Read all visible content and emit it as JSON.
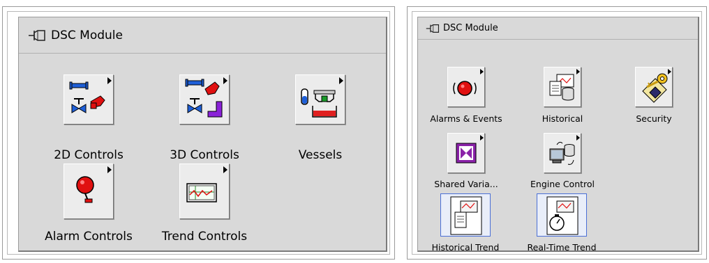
{
  "left_palette": {
    "title": "DSC Module",
    "items": [
      {
        "label": "2D Controls",
        "icon": "2d-controls-icon"
      },
      {
        "label": "3D Controls",
        "icon": "3d-controls-icon"
      },
      {
        "label": "Vessels",
        "icon": "vessels-icon"
      },
      {
        "label": "Alarm Controls",
        "icon": "alarm-controls-icon"
      },
      {
        "label": "Trend Controls",
        "icon": "trend-controls-icon"
      }
    ]
  },
  "right_palette": {
    "title": "DSC Module",
    "items": [
      {
        "label": "Alarms & Events",
        "icon": "alarms-events-icon"
      },
      {
        "label": "Historical",
        "icon": "historical-icon"
      },
      {
        "label": "Security",
        "icon": "security-icon"
      },
      {
        "label": "Shared Varia...",
        "icon": "shared-variable-icon"
      },
      {
        "label": "Engine Control",
        "icon": "engine-control-icon"
      },
      {
        "label": "Historical Trend",
        "icon": "historical-trend-icon"
      },
      {
        "label": "Real-Time Trend",
        "icon": "real-time-trend-icon"
      }
    ]
  },
  "colors": {
    "palette_bg": "#d9d9d9",
    "selection_border": "#4a6fd6",
    "pipe_blue": "#1e5fd8",
    "valve_red": "#e01010",
    "tank_red": "#e02020",
    "pipe_purple": "#8a22d8"
  }
}
